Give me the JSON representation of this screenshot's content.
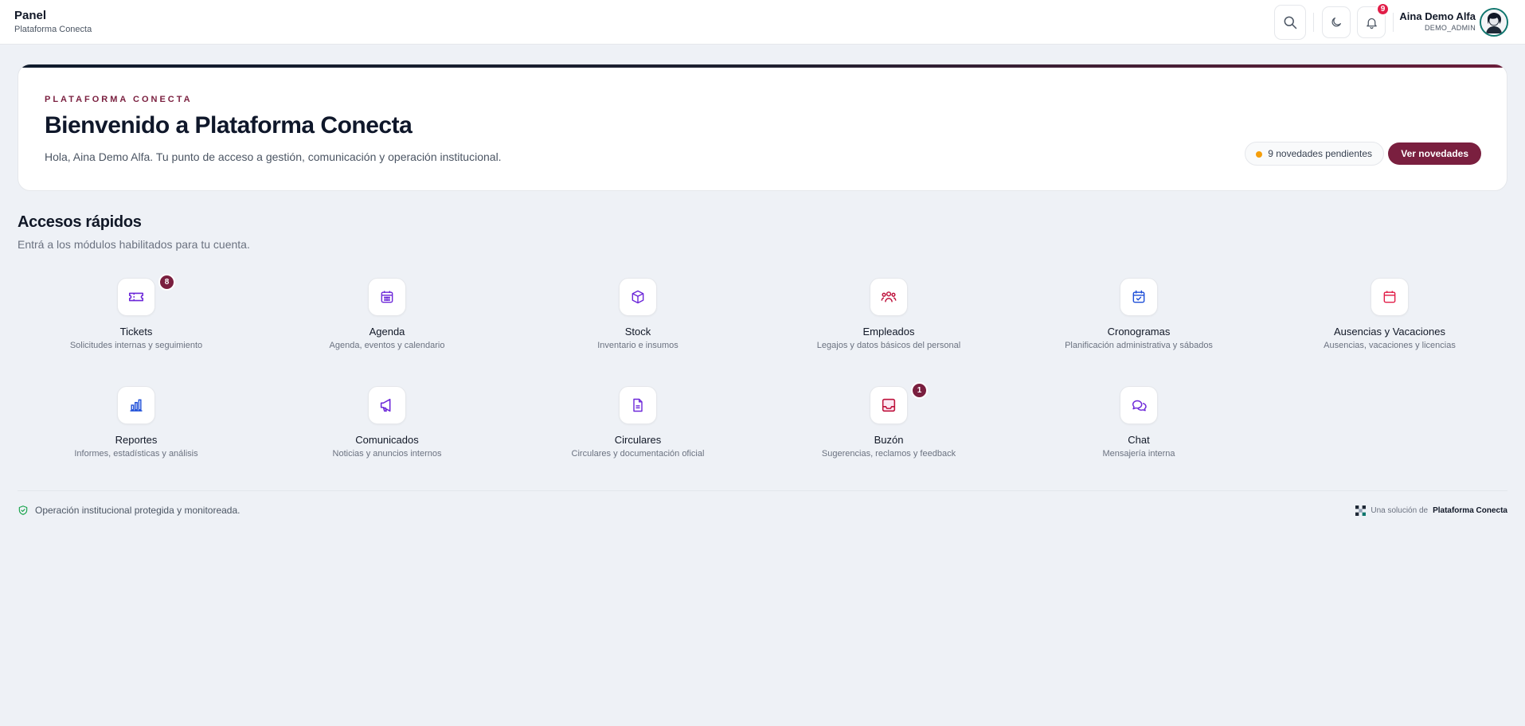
{
  "header": {
    "title": "Panel",
    "subtitle": "Plataforma Conecta",
    "notifications_count": "9",
    "user_name": "Aina Demo Alfa",
    "user_role": "DEMO_ADMIN"
  },
  "hero": {
    "eyebrow": "PLATAFORMA CONECTA",
    "headline": "Bienvenido a Plataforma Conecta",
    "greeting": "Hola, Aina Demo Alfa. Tu punto de acceso a gestión, comunicación y operación institucional.",
    "pending_label": "9 novedades pendientes",
    "cta_label": "Ver novedades"
  },
  "quick_access": {
    "title": "Accesos rápidos",
    "subtitle": "Entrá a los módulos habilitados para tu cuenta.",
    "modules": [
      {
        "name": "Tickets",
        "desc": "Solicitudes internas y seguimiento",
        "badge": "8",
        "icon": "ticket-icon"
      },
      {
        "name": "Agenda",
        "desc": "Agenda, eventos y calendario",
        "badge": "",
        "icon": "calendar-icon"
      },
      {
        "name": "Stock",
        "desc": "Inventario e insumos",
        "badge": "",
        "icon": "box-icon"
      },
      {
        "name": "Empleados",
        "desc": "Legajos y datos básicos del personal",
        "badge": "",
        "icon": "users-icon"
      },
      {
        "name": "Cronogramas",
        "desc": "Planificación administrativa y sábados",
        "badge": "",
        "icon": "calendar-check-icon"
      },
      {
        "name": "Ausencias y Vacaciones",
        "desc": "Ausencias, vacaciones y licencias",
        "badge": "",
        "icon": "calendar-icon"
      },
      {
        "name": "Reportes",
        "desc": "Informes, estadísticas y análisis",
        "badge": "",
        "icon": "bar-chart-icon"
      },
      {
        "name": "Comunicados",
        "desc": "Noticias y anuncios internos",
        "badge": "",
        "icon": "megaphone-icon"
      },
      {
        "name": "Circulares",
        "desc": "Circulares y documentación oficial",
        "badge": "",
        "icon": "document-icon"
      },
      {
        "name": "Buzón",
        "desc": "Sugerencias, reclamos y feedback",
        "badge": "1",
        "icon": "inbox-icon"
      },
      {
        "name": "Chat",
        "desc": "Mensajería interna",
        "badge": "",
        "icon": "chat-icon"
      }
    ]
  },
  "footer": {
    "status_text": "Operación institucional protegida y monitoreada.",
    "credit_prefix": "Una solución de",
    "credit_brand": "Plataforma Conecta"
  },
  "colors": {
    "brand": "#7a1f3f",
    "icon_purple": "#6d28d9",
    "icon_blue": "#1d4ed8",
    "icon_red": "#e11d48",
    "secure_green": "#16a34a"
  }
}
